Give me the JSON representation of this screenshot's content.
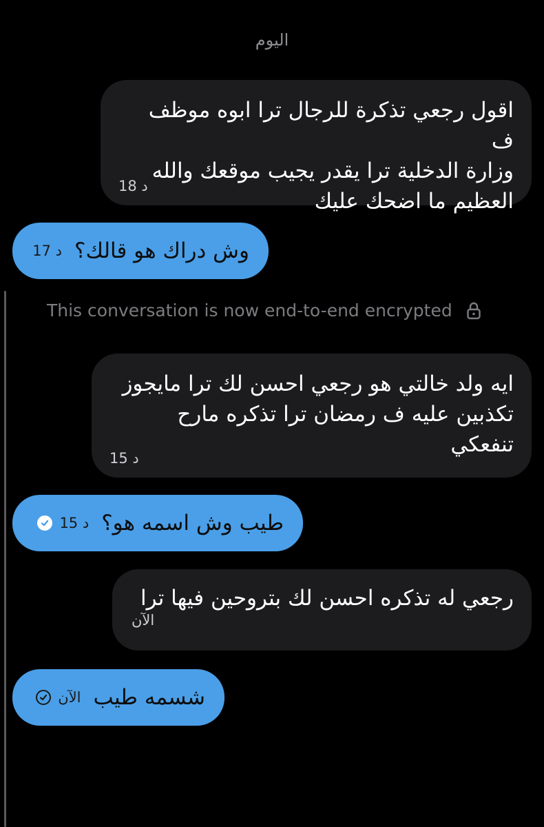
{
  "header": {
    "date_label": "اليوم"
  },
  "messages": [
    {
      "id": "m1",
      "side": "received",
      "text": "اقول رجعي تذكرة للرجال ترا ابوه موظف ف\nوزارة الدخلية ترا يقدر يجيب موقعك والله\nالعظيم ما اضحك عليك",
      "time": "18 د"
    },
    {
      "id": "m2",
      "side": "sent",
      "text": "وش دراك هو قالك؟",
      "time": "17 د"
    },
    {
      "id": "m3",
      "side": "received",
      "text": "ايه ولد خالتي هو رجعي احسن لك ترا مايجوز\nتكذبين عليه ف رمضان ترا تذكره مارح\nتنفعكي",
      "time": "15 د"
    },
    {
      "id": "m4",
      "side": "sent",
      "text": "طيب وش اسمه هو؟",
      "time": "15 د",
      "status": "read"
    },
    {
      "id": "m5",
      "side": "received",
      "text": "رجعي له تذكره احسن لك بتروحين فيها ترا",
      "time": "الآن"
    },
    {
      "id": "m6",
      "side": "sent",
      "text": "شسمه طيب",
      "time": "الآن",
      "status": "sent"
    }
  ],
  "encryption_notice": {
    "text": "This conversation is now end-to-end encrypted",
    "icon": "lock-icon"
  },
  "colors": {
    "sent_bubble": "#4a9fe8",
    "received_bubble": "#1c1c1e",
    "background": "#000000"
  }
}
